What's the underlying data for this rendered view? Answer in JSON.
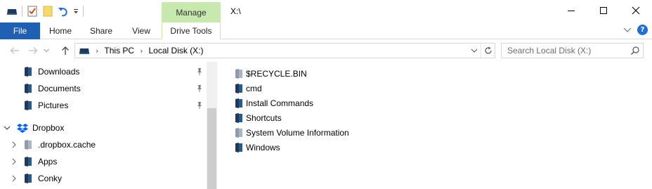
{
  "titlebar": {
    "manage_label": "Manage",
    "window_title": "X:\\"
  },
  "ribbon": {
    "tabs": [
      {
        "label": "File"
      },
      {
        "label": "Home"
      },
      {
        "label": "Share"
      },
      {
        "label": "View"
      },
      {
        "label": "Drive Tools"
      }
    ],
    "help_label": "?"
  },
  "address": {
    "breadcrumb": [
      "This PC",
      "Local Disk (X:)"
    ],
    "search_placeholder": "Search Local Disk (X:)"
  },
  "nav_pane": {
    "items": [
      {
        "label": "Downloads",
        "icon": "folder-drive-icon",
        "pinned": true
      },
      {
        "label": "Documents",
        "icon": "folder-drive-icon",
        "pinned": true
      },
      {
        "label": "Pictures",
        "icon": "folder-drive-icon",
        "pinned": true
      },
      {
        "label": "Dropbox",
        "icon": "dropbox-icon",
        "expanded": true
      },
      {
        "label": ".dropbox.cache",
        "icon": "folder-hidden-icon"
      },
      {
        "label": "Apps",
        "icon": "folder-drive-icon"
      },
      {
        "label": "Conky",
        "icon": "folder-drive-icon"
      }
    ],
    "scroll_fraction_visible": 0.64
  },
  "files": [
    {
      "name": "$RECYCLE.BIN",
      "icon": "folder-hidden-icon"
    },
    {
      "name": "cmd",
      "icon": "folder-drive-icon"
    },
    {
      "name": "Install Commands",
      "icon": "folder-drive-icon"
    },
    {
      "name": "Shortcuts",
      "icon": "folder-drive-icon"
    },
    {
      "name": "System Volume Information",
      "icon": "folder-hidden-icon"
    },
    {
      "name": "Windows",
      "icon": "folder-drive-icon"
    }
  ],
  "colors": {
    "file_tab": "#1f5fb4",
    "manage_tab": "#c8e9ad",
    "folder_dark": "#1b3a5e",
    "folder_hidden": "#8e9aab",
    "dropbox": "#0061fe"
  }
}
